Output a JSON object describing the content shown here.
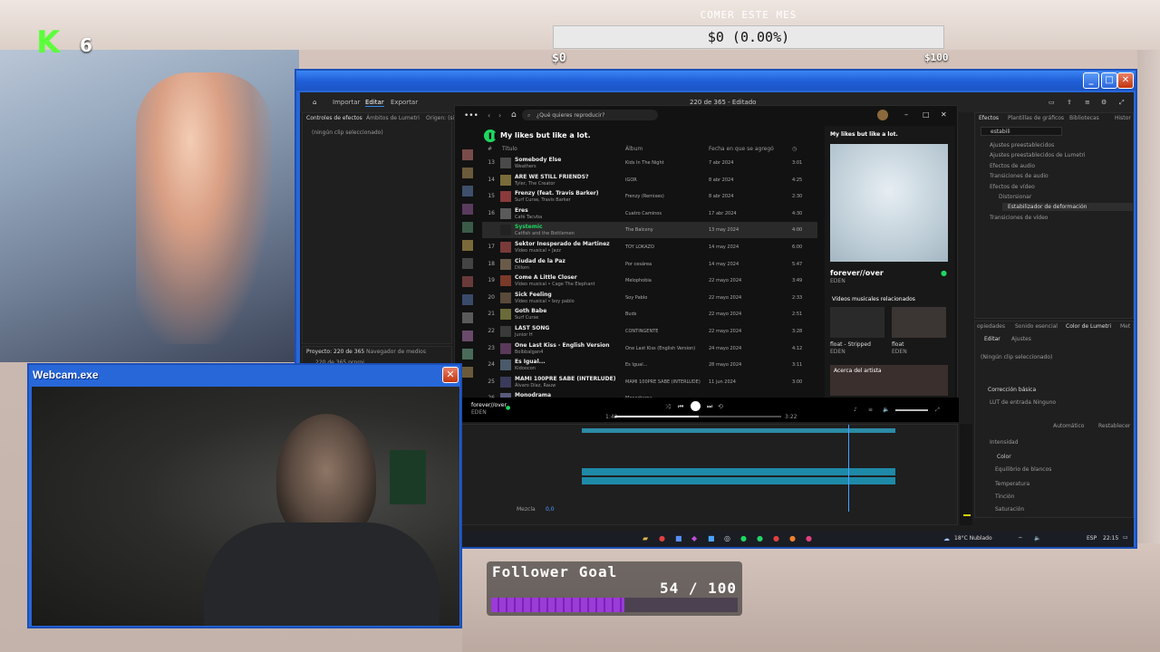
{
  "stream": {
    "platform_logo": "K",
    "viewer_count": "6",
    "goal": {
      "title": "COMER ESTE MES",
      "value": "$0 (0.00%)",
      "min": "$0",
      "max": "$100"
    },
    "follower_goal": {
      "label": "Follower Goal",
      "count": "54 / 100",
      "progress": 0.54
    },
    "webcam": {
      "title": "Webcam.exe",
      "close": "✕"
    }
  },
  "main_window": {
    "close": "✕"
  },
  "premiere": {
    "title": "220 de 365 - Editado",
    "tabs": [
      "Importar",
      "Editar",
      "Exportar"
    ],
    "source_tabs": [
      "Controles de efectos",
      "Ámbitos de Lumetri",
      "Origen: (sin"
    ],
    "no_clip": "(ningún clip seleccionado)",
    "project_tab": "Proyecto: 220 de 365",
    "media_browser": "Navegador de medios",
    "project_file": "220 de 365.prproj",
    "effects_tabs": [
      "Efectos",
      "Plantillas de gráficos",
      "Bibliotecas",
      "Histor"
    ],
    "effects_search": "estabili",
    "effects_tree": [
      "Ajustes preestablecidos",
      "Ajustes preestablecidos de Lumetri",
      "Efectos de audio",
      "Transiciones de audio",
      "Efectos de vídeo",
      "Distorsionar",
      "Estabilizador de deformación",
      "Transiciones de vídeo"
    ],
    "lumetri_tabs": [
      "opiedades",
      "Sonido esencial",
      "Color de Lumetri",
      "Met"
    ],
    "lumetri_subtabs": [
      "Editar",
      "Ajustes"
    ],
    "lumetri_no_clip": "(Ningún clip seleccionado)",
    "lumetri_sections": [
      "Corrección básica",
      "LUT de entrada",
      "Ninguno",
      "Intensidad",
      "Color",
      "Equilibrio de blancos",
      "Temperatura",
      "Tinción",
      "Saturación"
    ],
    "auto_btn": "Automático",
    "reset_btn": "Restablecer",
    "mix_label": "Mezcla",
    "mix_value": "0,0"
  },
  "spotify": {
    "search_placeholder": "¿Qué quieres reproducir?",
    "playlist_title": "My likes but like a lot.",
    "columns": [
      "#",
      "Título",
      "Álbum",
      "Fecha en que se agregó",
      "◷"
    ],
    "rows": [
      {
        "num": "13",
        "title": "Somebody Else",
        "artist": "Weathers",
        "album": "Kids In The Night",
        "date": "7 abr 2024",
        "dur": "3:01"
      },
      {
        "num": "14",
        "title": "ARE WE STILL FRIENDS?",
        "artist": "Tyler, The Creator",
        "album": "IGOR",
        "date": "8 abr 2024",
        "dur": "4:25"
      },
      {
        "num": "15",
        "title": "Frenzy (feat. Travis Barker)",
        "artist": "Surf Curse, Travis Barker",
        "album": "Frenzy (Remixes)",
        "date": "8 abr 2024",
        "dur": "2:30"
      },
      {
        "num": "16",
        "title": "Eres",
        "artist": "Café Tacvba",
        "album": "Cuatro Caminos",
        "date": "17 abr 2024",
        "dur": "4:30"
      },
      {
        "num": "",
        "title": "Systemic",
        "artist": "Catfish and the Bottlemen",
        "album": "The Balcony",
        "date": "13 may 2024",
        "dur": "4:00"
      },
      {
        "num": "17",
        "title": "Sektor Inesperado de Martinez",
        "artist": "Vídeo musical • Jazz",
        "album": "TOY LOKAZO",
        "date": "14 may 2024",
        "dur": "6:00"
      },
      {
        "num": "18",
        "title": "Ciudad de la Paz",
        "artist": "Dillom",
        "album": "Por cesárea",
        "date": "14 may 2024",
        "dur": "5:47"
      },
      {
        "num": "19",
        "title": "Come A Little Closer",
        "artist": "Vídeo musical • Cage The Elephant",
        "album": "Melophobia",
        "date": "22 mayo 2024",
        "dur": "3:49"
      },
      {
        "num": "20",
        "title": "Sick Feeling",
        "artist": "Vídeo musical • boy pablo",
        "album": "Soy Pablo",
        "date": "22 mayo 2024",
        "dur": "2:33"
      },
      {
        "num": "21",
        "title": "Goth Babe",
        "artist": "Surf Curse",
        "album": "Buds",
        "date": "22 mayo 2024",
        "dur": "2:51"
      },
      {
        "num": "22",
        "title": "LAST SONG",
        "artist": "Junior H",
        "album": "CONTINGENTE",
        "date": "22 mayo 2024",
        "dur": "3:28"
      },
      {
        "num": "23",
        "title": "One Last Kiss - English Version",
        "artist": "Bolbbalgan4",
        "album": "One Last Kiss (English Version)",
        "date": "24 mayo 2024",
        "dur": "4:12"
      },
      {
        "num": "24",
        "title": "Es Igual...",
        "artist": "Kidoocon",
        "album": "Es Igual...",
        "date": "28 mayo 2024",
        "dur": "3:11"
      },
      {
        "num": "25",
        "title": "MAMI 100PRE SABE (INTERLUDE)",
        "artist": "Álvaro Díaz, Rauw",
        "album": "MAMI 100PRE SABE (INTERLUDE)",
        "date": "11 jun 2024",
        "dur": "3:00"
      },
      {
        "num": "26",
        "title": "Monodrama",
        "artist": "",
        "album": "Monodrama",
        "date": "",
        "dur": ""
      }
    ],
    "now_playing_panel_title": "My likes but like a lot.",
    "now_track": "forever//over",
    "now_artist": "EDEN",
    "related_videos": "Vídeos musicales relacionados",
    "rel1_title": "float - Stripped",
    "rel1_artist": "EDEN",
    "rel2_title": "float",
    "rel2_artist": "EDEN",
    "about_artist": "Acerca del artista",
    "player_time_left": "1:42",
    "player_time_right": "3:22",
    "player_track": "forever//over",
    "player_artist": "EDEN"
  },
  "taskbar": {
    "weather": "18°C Nublado",
    "lang": "ESP",
    "time": "22:15"
  },
  "colors": {
    "xp_blue": "#2767d8",
    "spotify_green": "#1ed760",
    "premiere_accent": "#2d8ceb",
    "kick_green": "#5bff3a",
    "goal_purple": "#9b3bd8"
  }
}
